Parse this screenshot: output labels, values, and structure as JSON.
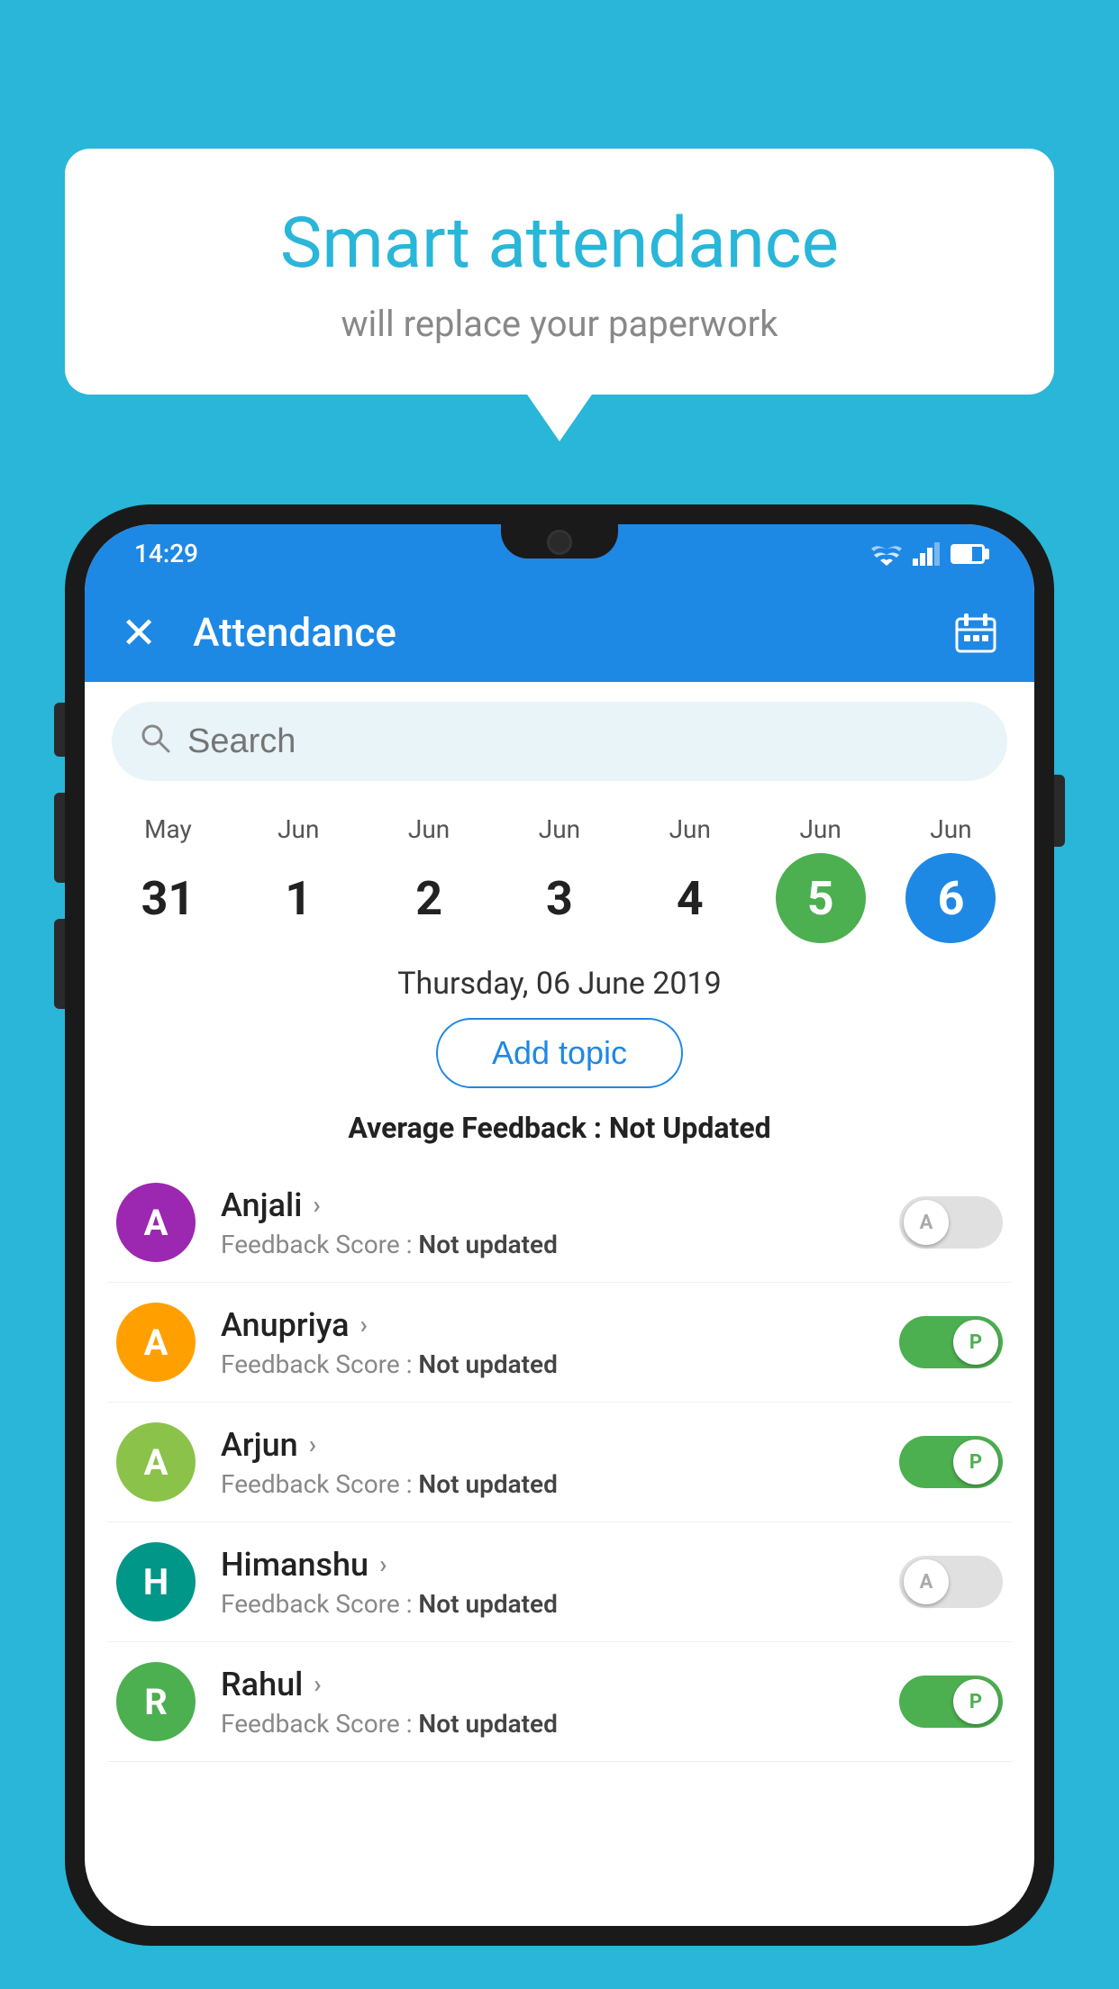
{
  "background_color": "#29b6d8",
  "speech_bubble": {
    "title": "Smart attendance",
    "subtitle": "will replace your paperwork"
  },
  "status_bar": {
    "time": "14:29",
    "wifi": "wifi",
    "signal": "signal",
    "battery": "battery"
  },
  "app_bar": {
    "close_label": "✕",
    "title": "Attendance",
    "calendar_icon": "calendar-icon"
  },
  "search": {
    "placeholder": "Search"
  },
  "calendar": {
    "days": [
      {
        "month": "May",
        "date": "31",
        "state": "normal"
      },
      {
        "month": "Jun",
        "date": "1",
        "state": "normal"
      },
      {
        "month": "Jun",
        "date": "2",
        "state": "normal"
      },
      {
        "month": "Jun",
        "date": "3",
        "state": "normal"
      },
      {
        "month": "Jun",
        "date": "4",
        "state": "normal"
      },
      {
        "month": "Jun",
        "date": "5",
        "state": "today"
      },
      {
        "month": "Jun",
        "date": "6",
        "state": "selected"
      }
    ]
  },
  "selected_date": "Thursday, 06 June 2019",
  "add_topic_label": "Add topic",
  "avg_feedback_label": "Average Feedback : ",
  "avg_feedback_value": "Not Updated",
  "students": [
    {
      "name": "Anjali",
      "initial": "A",
      "avatar_color": "purple",
      "feedback_label": "Feedback Score : ",
      "feedback_value": "Not updated",
      "toggle": "off"
    },
    {
      "name": "Anupriya",
      "initial": "A",
      "avatar_color": "amber",
      "feedback_label": "Feedback Score : ",
      "feedback_value": "Not updated",
      "toggle": "on"
    },
    {
      "name": "Arjun",
      "initial": "A",
      "avatar_color": "light-green",
      "feedback_label": "Feedback Score : ",
      "feedback_value": "Not updated",
      "toggle": "on"
    },
    {
      "name": "Himanshu",
      "initial": "H",
      "avatar_color": "teal",
      "feedback_label": "Feedback Score : ",
      "feedback_value": "Not updated",
      "toggle": "off"
    },
    {
      "name": "Rahul",
      "initial": "R",
      "avatar_color": "green",
      "feedback_label": "Feedback Score : ",
      "feedback_value": "Not updated",
      "toggle": "on"
    }
  ]
}
